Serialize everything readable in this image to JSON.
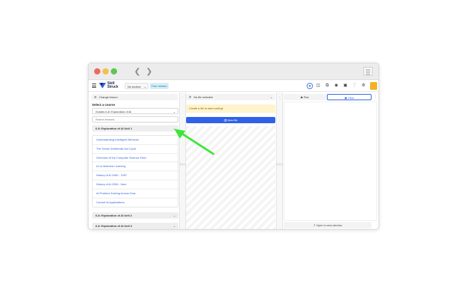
{
  "app": {
    "logo_line1": "Skill",
    "logo_line2": "Struck",
    "section_select": "No section",
    "plan_badge": "Free version",
    "accent_color": "#2f62e6",
    "annotation_arrow_color": "#3ee63a"
  },
  "icons": {
    "toolbar": [
      "help-circle-icon",
      "layout-icon",
      "copy-icon",
      "chat-icon",
      "image-icon",
      "question-icon",
      "gear-icon",
      "avatar-icon"
    ]
  },
  "sidebar": {
    "change_lesson_label": "Change lesson",
    "select_course_label": "Select a course",
    "course_value": "Grades 6-8: Exploration of AI",
    "search_placeholder": "Search lessons",
    "units": [
      {
        "title": "6-8: Exploration of AI Unit 1",
        "expanded": true,
        "lessons": [
          "Understanding Intelligent Behavior",
          "The Sense-Deliberate-Act Cycle",
          "Overview of the Computer Science Field",
          "AI vs Machine Learning",
          "History of AI 1950 - 1997",
          "History of AI 2006 - Now",
          "AI Problem Solving Across Eras",
          "Current AI Applications"
        ]
      },
      {
        "title": "6-8: Exploration of AI Unit 2",
        "expanded": false
      },
      {
        "title": "6-8: Exploration of AI Unit 3",
        "expanded": false
      }
    ]
  },
  "editor": {
    "file_selector": "No file selected",
    "notice": "Create a file to start coding!",
    "new_file_button": "New file"
  },
  "preview": {
    "run_button": "Run",
    "view_button": "View",
    "open_new_window": "Open in new window"
  },
  "dividers": {
    "grip": "|<|>|"
  }
}
